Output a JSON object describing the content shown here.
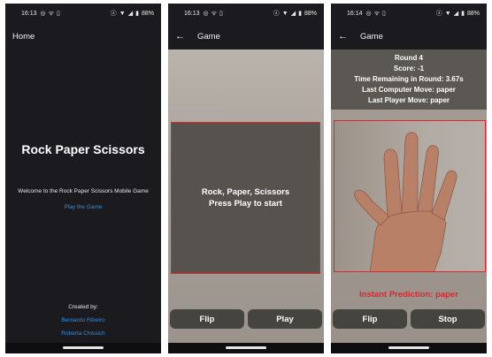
{
  "status_bars": [
    {
      "time": "16:13",
      "battery": "88%"
    },
    {
      "time": "16:13",
      "battery": "88%"
    },
    {
      "time": "16:14",
      "battery": "88%"
    }
  ],
  "home": {
    "appbar_title": "Home",
    "title": "Rock Paper Scissors",
    "welcome": "Welcome to the Rock Paper Scissors Mobile Game",
    "play_link": "Play the Game",
    "created_by_label": "Created by:",
    "creators": [
      "Bernardo Ribeiro",
      "Roberta Chissich"
    ]
  },
  "game_start": {
    "appbar_title": "Game",
    "prompt_line1": "Rock, Paper, Scissors",
    "prompt_line2": "Press Play to start",
    "flip_label": "Flip",
    "play_label": "Play"
  },
  "game_running": {
    "appbar_title": "Game",
    "round": "Round 4",
    "score": "Score: -1",
    "time_remaining": "Time Remaining in Round: 3.67s",
    "last_computer_move": "Last Computer Move: paper",
    "last_player_move": "Last Player Move: paper",
    "prediction": "Instant Prediction: paper",
    "flip_label": "Flip",
    "stop_label": "Stop"
  },
  "colors": {
    "background_dark": "#1b1b1f",
    "accent_link": "#2d8fe0",
    "detection_red": "#e3242b",
    "button_bg": "#46443f"
  },
  "icons": [
    "whatsapp-icon",
    "wifi-calling-icon",
    "nfc-icon",
    "mute-icon",
    "wifi-icon",
    "signal-icon",
    "battery-icon",
    "back-arrow-icon"
  ]
}
